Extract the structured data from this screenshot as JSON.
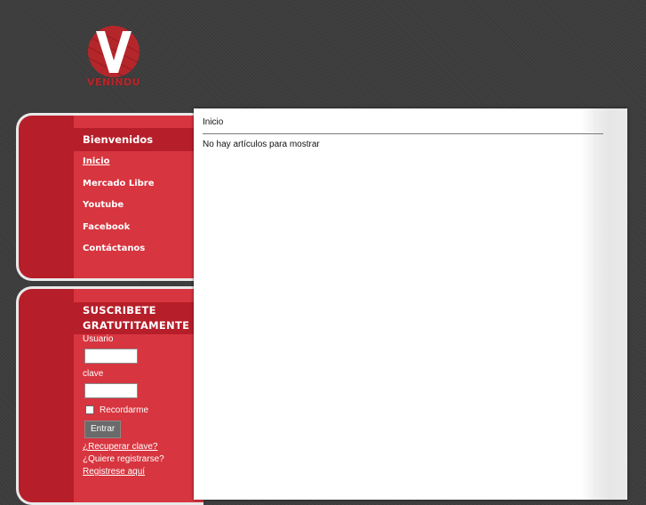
{
  "brand": {
    "logo_icon": "v-logo-icon",
    "name": "VENINDU",
    "color": "#b5262b"
  },
  "menu": {
    "title": "Bienvenidos",
    "items": [
      {
        "label": "Inicio",
        "active": true
      },
      {
        "label": "Mercado Libre"
      },
      {
        "label": "Youtube"
      },
      {
        "label": "Facebook"
      },
      {
        "label": "Contáctanos"
      }
    ]
  },
  "subscribe": {
    "title_line1": "SUSCRIBETE",
    "title_line2": "GRATUTITAMENTE",
    "username_label": "Usuario",
    "username_value": "",
    "password_label": "clave",
    "password_value": "",
    "remember_label": "Recordarme",
    "remember_checked": false,
    "login_button": "Entrar",
    "recover_link": "¿Recuperar clave?",
    "register_question": "¿Quiere registrarse?",
    "register_link": "Registrese aquí"
  },
  "content": {
    "breadcrumb": "Inicio",
    "empty_message": "No hay artículos para mostrar"
  },
  "colors": {
    "background": "#3b3b3b",
    "panel_dark": "#b61e29",
    "panel_light": "#d7353f",
    "content_bg": "#ffffff"
  }
}
